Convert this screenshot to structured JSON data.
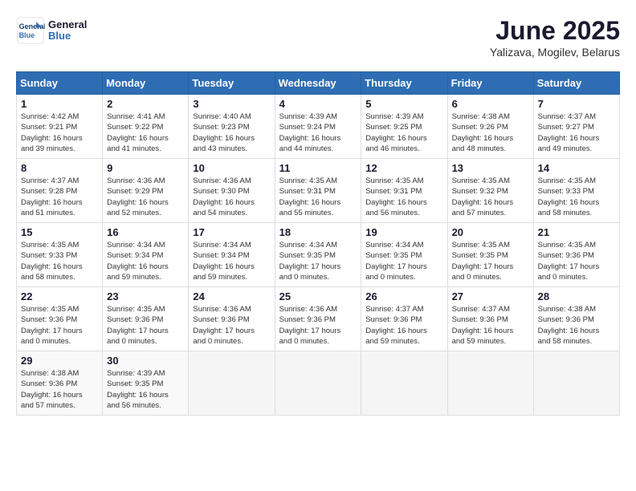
{
  "header": {
    "logo_line1": "General",
    "logo_line2": "Blue",
    "month_year": "June 2025",
    "location": "Yalizava, Mogilev, Belarus"
  },
  "days_of_week": [
    "Sunday",
    "Monday",
    "Tuesday",
    "Wednesday",
    "Thursday",
    "Friday",
    "Saturday"
  ],
  "weeks": [
    [
      {
        "day": "1",
        "info": "Sunrise: 4:42 AM\nSunset: 9:21 PM\nDaylight: 16 hours\nand 39 minutes."
      },
      {
        "day": "2",
        "info": "Sunrise: 4:41 AM\nSunset: 9:22 PM\nDaylight: 16 hours\nand 41 minutes."
      },
      {
        "day": "3",
        "info": "Sunrise: 4:40 AM\nSunset: 9:23 PM\nDaylight: 16 hours\nand 43 minutes."
      },
      {
        "day": "4",
        "info": "Sunrise: 4:39 AM\nSunset: 9:24 PM\nDaylight: 16 hours\nand 44 minutes."
      },
      {
        "day": "5",
        "info": "Sunrise: 4:39 AM\nSunset: 9:25 PM\nDaylight: 16 hours\nand 46 minutes."
      },
      {
        "day": "6",
        "info": "Sunrise: 4:38 AM\nSunset: 9:26 PM\nDaylight: 16 hours\nand 48 minutes."
      },
      {
        "day": "7",
        "info": "Sunrise: 4:37 AM\nSunset: 9:27 PM\nDaylight: 16 hours\nand 49 minutes."
      }
    ],
    [
      {
        "day": "8",
        "info": "Sunrise: 4:37 AM\nSunset: 9:28 PM\nDaylight: 16 hours\nand 51 minutes."
      },
      {
        "day": "9",
        "info": "Sunrise: 4:36 AM\nSunset: 9:29 PM\nDaylight: 16 hours\nand 52 minutes."
      },
      {
        "day": "10",
        "info": "Sunrise: 4:36 AM\nSunset: 9:30 PM\nDaylight: 16 hours\nand 54 minutes."
      },
      {
        "day": "11",
        "info": "Sunrise: 4:35 AM\nSunset: 9:31 PM\nDaylight: 16 hours\nand 55 minutes."
      },
      {
        "day": "12",
        "info": "Sunrise: 4:35 AM\nSunset: 9:31 PM\nDaylight: 16 hours\nand 56 minutes."
      },
      {
        "day": "13",
        "info": "Sunrise: 4:35 AM\nSunset: 9:32 PM\nDaylight: 16 hours\nand 57 minutes."
      },
      {
        "day": "14",
        "info": "Sunrise: 4:35 AM\nSunset: 9:33 PM\nDaylight: 16 hours\nand 58 minutes."
      }
    ],
    [
      {
        "day": "15",
        "info": "Sunrise: 4:35 AM\nSunset: 9:33 PM\nDaylight: 16 hours\nand 58 minutes."
      },
      {
        "day": "16",
        "info": "Sunrise: 4:34 AM\nSunset: 9:34 PM\nDaylight: 16 hours\nand 59 minutes."
      },
      {
        "day": "17",
        "info": "Sunrise: 4:34 AM\nSunset: 9:34 PM\nDaylight: 16 hours\nand 59 minutes."
      },
      {
        "day": "18",
        "info": "Sunrise: 4:34 AM\nSunset: 9:35 PM\nDaylight: 17 hours\nand 0 minutes."
      },
      {
        "day": "19",
        "info": "Sunrise: 4:34 AM\nSunset: 9:35 PM\nDaylight: 17 hours\nand 0 minutes."
      },
      {
        "day": "20",
        "info": "Sunrise: 4:35 AM\nSunset: 9:35 PM\nDaylight: 17 hours\nand 0 minutes."
      },
      {
        "day": "21",
        "info": "Sunrise: 4:35 AM\nSunset: 9:36 PM\nDaylight: 17 hours\nand 0 minutes."
      }
    ],
    [
      {
        "day": "22",
        "info": "Sunrise: 4:35 AM\nSunset: 9:36 PM\nDaylight: 17 hours\nand 0 minutes."
      },
      {
        "day": "23",
        "info": "Sunrise: 4:35 AM\nSunset: 9:36 PM\nDaylight: 17 hours\nand 0 minutes."
      },
      {
        "day": "24",
        "info": "Sunrise: 4:36 AM\nSunset: 9:36 PM\nDaylight: 17 hours\nand 0 minutes."
      },
      {
        "day": "25",
        "info": "Sunrise: 4:36 AM\nSunset: 9:36 PM\nDaylight: 17 hours\nand 0 minutes."
      },
      {
        "day": "26",
        "info": "Sunrise: 4:37 AM\nSunset: 9:36 PM\nDaylight: 16 hours\nand 59 minutes."
      },
      {
        "day": "27",
        "info": "Sunrise: 4:37 AM\nSunset: 9:36 PM\nDaylight: 16 hours\nand 59 minutes."
      },
      {
        "day": "28",
        "info": "Sunrise: 4:38 AM\nSunset: 9:36 PM\nDaylight: 16 hours\nand 58 minutes."
      }
    ],
    [
      {
        "day": "29",
        "info": "Sunrise: 4:38 AM\nSunset: 9:36 PM\nDaylight: 16 hours\nand 57 minutes."
      },
      {
        "day": "30",
        "info": "Sunrise: 4:39 AM\nSunset: 9:35 PM\nDaylight: 16 hours\nand 56 minutes."
      },
      {
        "day": "",
        "info": ""
      },
      {
        "day": "",
        "info": ""
      },
      {
        "day": "",
        "info": ""
      },
      {
        "day": "",
        "info": ""
      },
      {
        "day": "",
        "info": ""
      }
    ]
  ]
}
